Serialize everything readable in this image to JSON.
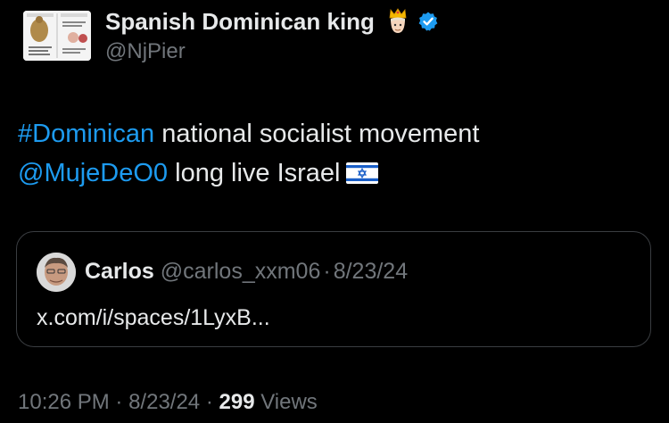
{
  "author": {
    "display_name": "Spanish Dominican king",
    "handle": "@NjPier",
    "avatar_icon": "meme-image-avatar",
    "badge_emoji": "crown-person-emoji",
    "verified_icon": "verified-badge-icon",
    "verified_color": "#1d9bf0"
  },
  "tweet": {
    "hashtag": "#Dominican",
    "text_line1": " national socialist movement",
    "mention": "@MujeDeO0",
    "text_line2": " long live Israel",
    "flag_icon": "israel-flag-emoji",
    "link_color": "#1d9bf0"
  },
  "quote": {
    "name": "Carlos",
    "handle": "@carlos_xxm06",
    "separator": "·",
    "date": "8/23/24",
    "text": "x.com/i/spaces/1LyxB..."
  },
  "footer": {
    "time": "10:26 PM",
    "separator": "·",
    "date": "8/23/24",
    "views_count": "299",
    "views_label": "Views"
  }
}
